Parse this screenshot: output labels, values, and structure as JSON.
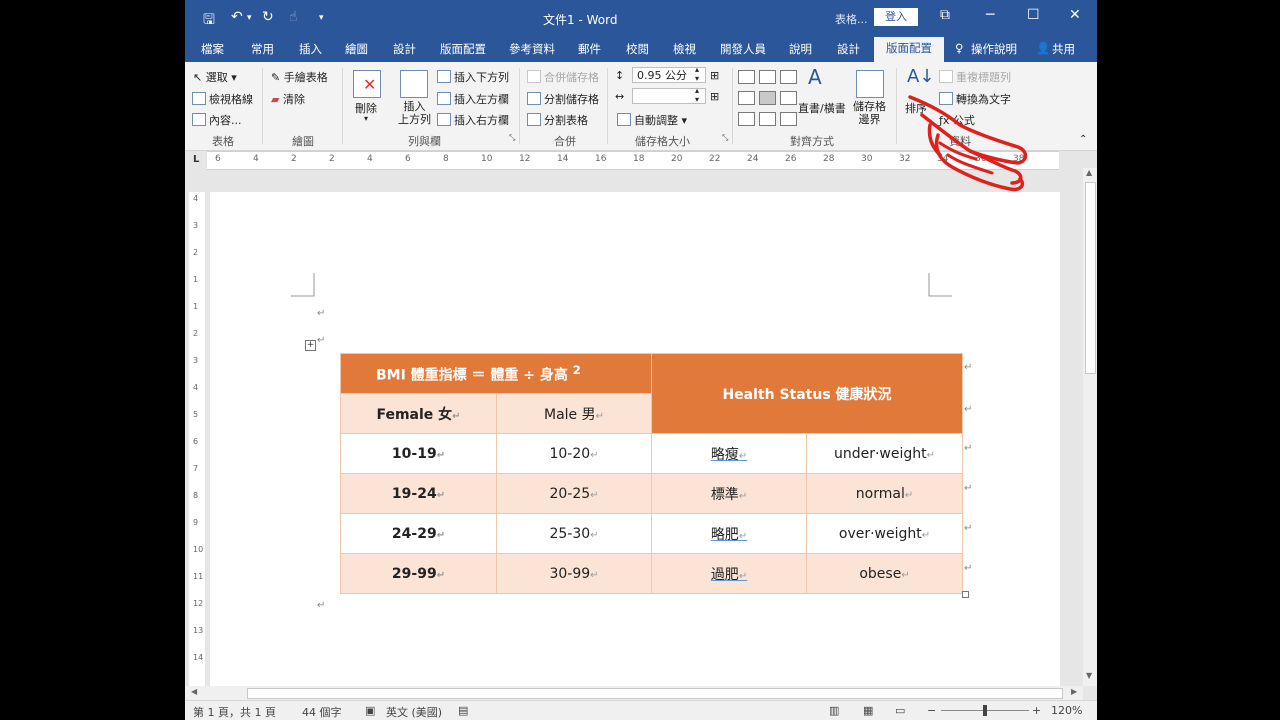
{
  "titlebar": {
    "title": "文件1 - Word",
    "table_tools": "表格...",
    "login": "登入"
  },
  "tabs": [
    "檔案",
    "常用",
    "插入",
    "繪圖",
    "設計",
    "版面配置",
    "參考資料",
    "郵件",
    "校閱",
    "檢視",
    "開發人員",
    "說明",
    "設計",
    "版面配置"
  ],
  "tell_me": "操作說明",
  "share": "共用",
  "ribbon": {
    "table": {
      "select": "選取",
      "gridlines": "檢視格線",
      "properties": "內容...",
      "group": "表格"
    },
    "draw": {
      "draw_table": "手繪表格",
      "eraser": "清除",
      "group": "繪圖"
    },
    "rows_cols": {
      "delete": "刪除",
      "insert_above": "插入\n上方列",
      "insert_below": "插入下方列",
      "insert_left": "插入左方欄",
      "insert_right": "插入右方欄",
      "group": "列與欄"
    },
    "merge": {
      "merge_cells": "合併儲存格",
      "split_cells": "分割儲存格",
      "split_table": "分割表格",
      "group": "合併"
    },
    "cell_size": {
      "height": "0.95 公分",
      "width": "",
      "autofit": "自動調整",
      "group": "儲存格大小"
    },
    "alignment": {
      "text_direction": "直書/橫書",
      "cell_margins": "儲存格\n邊界",
      "group": "對齊方式"
    },
    "data": {
      "sort": "排序",
      "repeat_header": "重複標題列",
      "convert": "轉換為文字",
      "formula": "公式",
      "group": "資料"
    }
  },
  "ruler_numbers": [
    "6",
    "4",
    "2",
    "2",
    "4",
    "6",
    "8",
    "10",
    "12",
    "14",
    "16",
    "18",
    "20",
    "22",
    "24",
    "26",
    "28",
    "30",
    "32",
    "34",
    "36",
    "38"
  ],
  "vruler_numbers": [
    "4",
    "3",
    "2",
    "1",
    "1",
    "2",
    "3",
    "4",
    "5",
    "6",
    "7",
    "8",
    "9",
    "10",
    "11",
    "12",
    "13",
    "14"
  ],
  "table": {
    "header_formula": "BMI 體重指標 ＝ 體重 ÷ 身高",
    "superscript": "2",
    "header_status": "Health Status 健康狀況",
    "female": "Female 女",
    "male": "Male 男",
    "rows": [
      {
        "female": "10-19",
        "male": "10-20",
        "zh": "略瘦",
        "en": "under·weight"
      },
      {
        "female": "19-24",
        "male": "20-25",
        "zh": "標準",
        "en": "normal"
      },
      {
        "female": "24-29",
        "male": "25-30",
        "zh": "略肥",
        "en": "over·weight"
      },
      {
        "female": "29-99",
        "male": "30-99",
        "zh": "過肥",
        "en": "obese"
      }
    ],
    "para_mark": "↵"
  },
  "status": {
    "page": "第 1 頁，共 1 頁",
    "words": "44 個字",
    "language": "英文 (美國)",
    "zoom": "120%"
  },
  "colors": {
    "word_blue": "#2b579a",
    "table_header": "#e0793a",
    "table_band": "#fbe4d5",
    "annotation": "#e0201c"
  }
}
